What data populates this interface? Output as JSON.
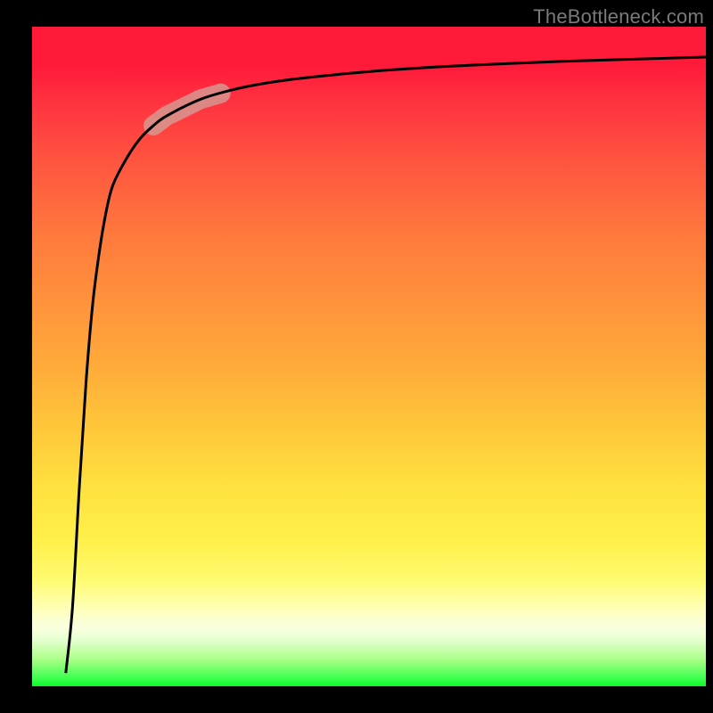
{
  "watermark": "TheBottleneck.com",
  "highlight": {
    "visible": true,
    "color_label": "muted-pink-band"
  },
  "chart_data": {
    "type": "line",
    "title": "",
    "xlabel": "",
    "ylabel": "",
    "ylim": [
      0,
      100
    ],
    "xlim": [
      0,
      100
    ],
    "series": [
      {
        "name": "bottleneck-curve",
        "x": [
          5,
          6,
          7,
          8,
          9,
          10,
          11,
          12,
          14,
          16,
          18,
          20,
          25,
          30,
          35,
          40,
          50,
          60,
          70,
          80,
          90,
          100
        ],
        "values": [
          2,
          12,
          30,
          46,
          58,
          66,
          72,
          76,
          80,
          83,
          85,
          86.5,
          89,
          90.5,
          91.5,
          92.2,
          93.2,
          93.9,
          94.4,
          94.8,
          95.1,
          95.4
        ]
      }
    ],
    "highlight_range_x": [
      18,
      28
    ]
  }
}
